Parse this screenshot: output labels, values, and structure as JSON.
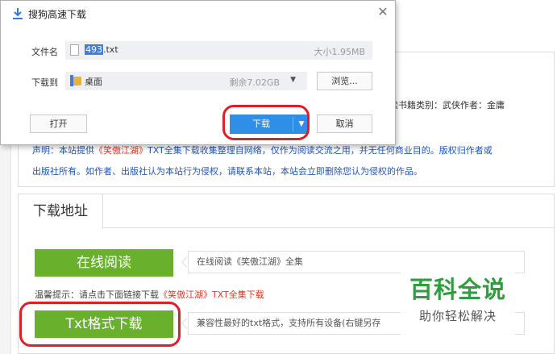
{
  "background": {
    "book_meta": "读书籍类别：武侠作者：金庸",
    "notice": {
      "part1": "声明：本站提供",
      "book": "《笑傲江湖》",
      "part2": "TXT全集下载收集整理自网络，仅作为阅读交流之用，并无任何商业目的。版权归作者或",
      "line2": "出版社所有。如作者、出版社认为本站行为侵权，请联系本站，本站会立即删除您认为侵权的作品。"
    },
    "tab_label": "下载地址",
    "online_read_label": "在线阅读",
    "online_read_desc": "在线阅读《笑傲江湖》全集",
    "tip_prefix": "温馨提示：请点击下面链接下载",
    "tip_book": "《笑傲江湖》",
    "tip_suffix": "TXT全集下载",
    "txt_download_label": "Txt格式下载",
    "txt_download_desc": "兼容性最好的txt格式，支持所有设备(右键另存"
  },
  "watermark": {
    "title": "百科全说",
    "subtitle": "助你轻松解决"
  },
  "dialog": {
    "title": "搜狗高速下载",
    "filename_label": "文件名",
    "filename_selected": "493",
    "filename_ext": ".txt",
    "file_size": "大小1.95MB",
    "save_to_label": "下载到",
    "path": "桌面",
    "remaining": "剩余7.02GB",
    "browse_label": "浏览...",
    "open_label": "打开",
    "download_label": "下载",
    "cancel_label": "取消"
  },
  "colors": {
    "accent_green": "#69b12d",
    "download_blue": "#2f8ee8",
    "highlight_red": "#e11d28",
    "link_blue": "#2255bb"
  }
}
